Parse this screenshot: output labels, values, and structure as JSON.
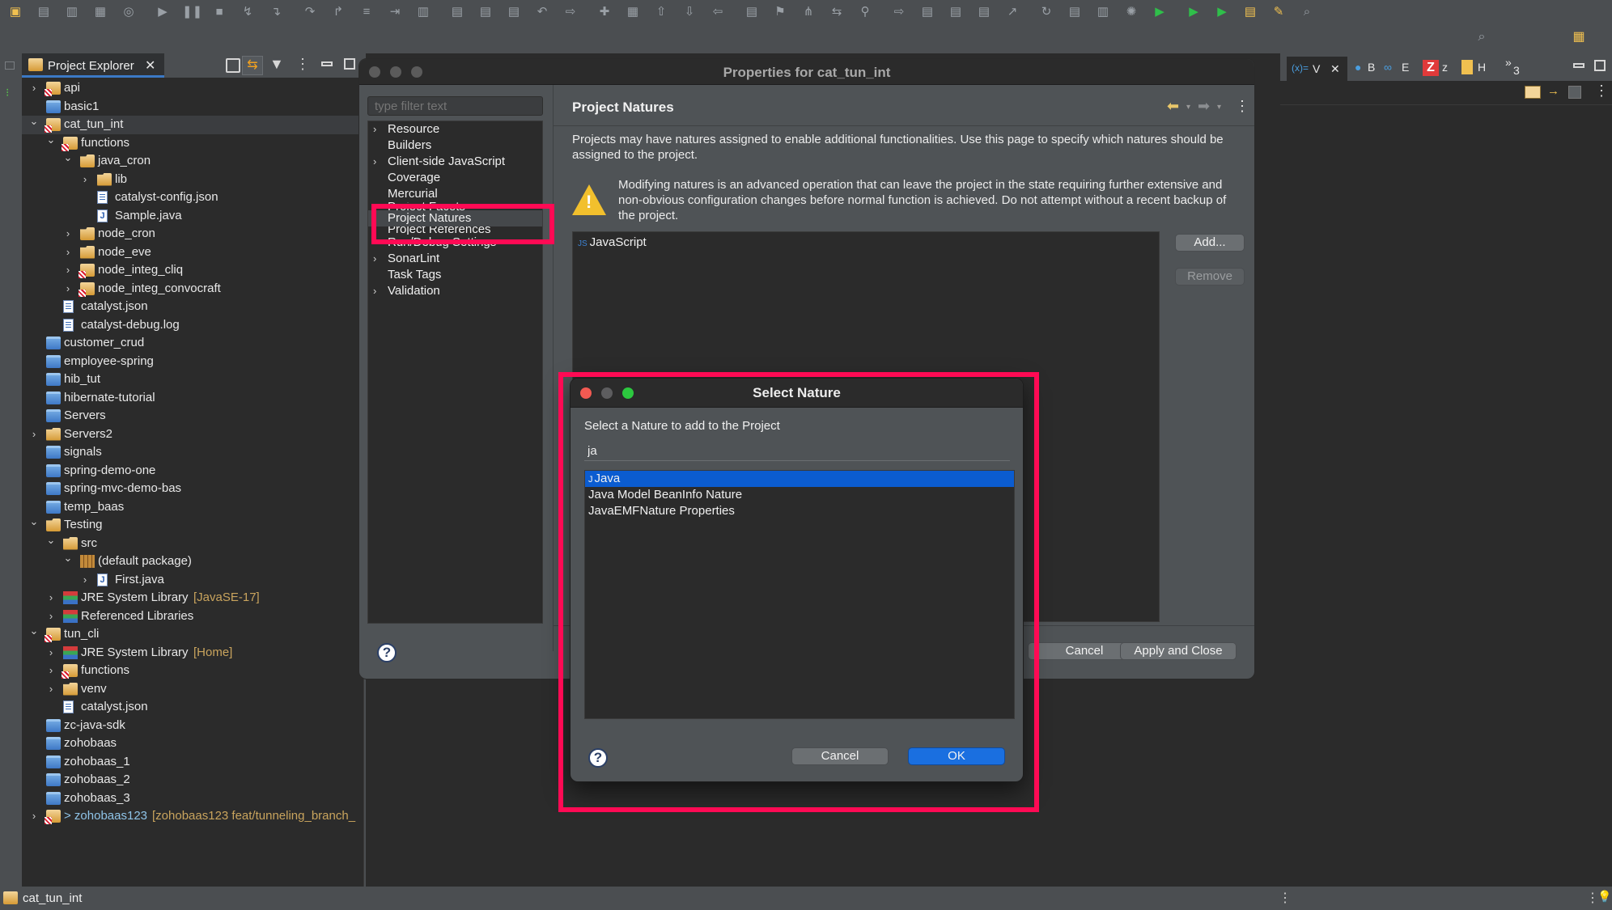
{
  "toolbar": {
    "icons": [
      "new-icon",
      "save-icon",
      "save-all-icon",
      "terminal-icon",
      "skip-breakpoints-icon",
      "resume-icon",
      "suspend-icon",
      "terminate-icon",
      "disconnect-icon",
      "step-into-icon",
      "step-over-icon",
      "step-return-icon",
      "drop-to-frame-icon",
      "use-step-filters-icon",
      "hg-icon-1",
      "hg-icon-2",
      "hg-icon-3",
      "hg-icon-4",
      "hg-undo-icon",
      "hg-import-icon",
      "hg-add-icon",
      "hg-binary-icon",
      "hg-push-icon",
      "hg-pull-icon",
      "hg-incoming-icon",
      "hg-history-icon",
      "hg-tag-icon",
      "hg-merge-icon",
      "hg-branch-icon",
      "hg-bisect-icon",
      "hg-export-icon",
      "hg-patch-icon",
      "hg-shelve-icon",
      "hg-unshelve-icon",
      "hg-rebase-icon",
      "hg-transplant-icon",
      "hg-editor-icon",
      "hg-sign-icon",
      "debug-icon",
      "run-icon",
      "run-last-icon",
      "coverage-icon",
      "open-type-icon",
      "open-task-icon",
      "search-icon"
    ]
  },
  "explorer": {
    "tab_label": "Project Explorer",
    "items": [
      {
        "label": "api",
        "level": 0,
        "chevron": ">",
        "icon": "project"
      },
      {
        "label": "basic1",
        "level": 0,
        "chevron": "",
        "icon": "folder"
      },
      {
        "label": "cat_tun_int",
        "level": 0,
        "chevron": "v",
        "icon": "project",
        "selected": true
      },
      {
        "label": "functions",
        "level": 1,
        "chevron": "v",
        "icon": "project"
      },
      {
        "label": "java_cron",
        "level": 2,
        "chevron": "v",
        "icon": "open"
      },
      {
        "label": "lib",
        "level": 3,
        "chevron": ">",
        "icon": "open"
      },
      {
        "label": "catalyst-config.json",
        "level": 3,
        "chevron": "",
        "icon": "file"
      },
      {
        "label": "Sample.java",
        "level": 3,
        "chevron": "",
        "icon": "java"
      },
      {
        "label": "node_cron",
        "level": 2,
        "chevron": ">",
        "icon": "open"
      },
      {
        "label": "node_eve",
        "level": 2,
        "chevron": ">",
        "icon": "open"
      },
      {
        "label": "node_integ_cliq",
        "level": 2,
        "chevron": ">",
        "icon": "project"
      },
      {
        "label": "node_integ_convocraft",
        "level": 2,
        "chevron": ">",
        "icon": "project"
      },
      {
        "label": "catalyst.json",
        "level": 1,
        "chevron": "",
        "icon": "file"
      },
      {
        "label": "catalyst-debug.log",
        "level": 1,
        "chevron": "",
        "icon": "file"
      },
      {
        "label": "customer_crud",
        "level": 0,
        "chevron": "",
        "icon": "folder"
      },
      {
        "label": "employee-spring",
        "level": 0,
        "chevron": "",
        "icon": "folder"
      },
      {
        "label": "hib_tut",
        "level": 0,
        "chevron": "",
        "icon": "folder"
      },
      {
        "label": "hibernate-tutorial",
        "level": 0,
        "chevron": "",
        "icon": "folder"
      },
      {
        "label": "Servers",
        "level": 0,
        "chevron": "",
        "icon": "folder"
      },
      {
        "label": "Servers2",
        "level": 0,
        "chevron": ">",
        "icon": "open"
      },
      {
        "label": "signals",
        "level": 0,
        "chevron": "",
        "icon": "folder"
      },
      {
        "label": "spring-demo-one",
        "level": 0,
        "chevron": "",
        "icon": "folder"
      },
      {
        "label": "spring-mvc-demo-bas",
        "level": 0,
        "chevron": "",
        "icon": "folder"
      },
      {
        "label": "temp_baas",
        "level": 0,
        "chevron": "",
        "icon": "folder"
      },
      {
        "label": "Testing",
        "level": 0,
        "chevron": "v",
        "icon": "open"
      },
      {
        "label": "src",
        "level": 1,
        "chevron": "v",
        "icon": "open"
      },
      {
        "label": "(default package)",
        "level": 2,
        "chevron": "v",
        "icon": "pkg"
      },
      {
        "label": "First.java",
        "level": 3,
        "chevron": ">",
        "icon": "java"
      },
      {
        "label": "JRE System Library",
        "decoration": "[JavaSE-17]",
        "level": 1,
        "chevron": ">",
        "icon": "lib"
      },
      {
        "label": "Referenced Libraries",
        "level": 1,
        "chevron": ">",
        "icon": "lib"
      },
      {
        "label": "tun_cli",
        "level": 0,
        "chevron": "v",
        "icon": "project"
      },
      {
        "label": "JRE System Library",
        "decoration": "[Home]",
        "level": 1,
        "chevron": ">",
        "icon": "lib"
      },
      {
        "label": "functions",
        "level": 1,
        "chevron": ">",
        "icon": "project"
      },
      {
        "label": "venv",
        "level": 1,
        "chevron": ">",
        "icon": "open"
      },
      {
        "label": "catalyst.json",
        "level": 1,
        "chevron": "",
        "icon": "file"
      },
      {
        "label": "zc-java-sdk",
        "level": 0,
        "chevron": "",
        "icon": "folder"
      },
      {
        "label": "zohobaas",
        "level": 0,
        "chevron": "",
        "icon": "folder"
      },
      {
        "label": "zohobaas_1",
        "level": 0,
        "chevron": "",
        "icon": "folder"
      },
      {
        "label": "zohobaas_2",
        "level": 0,
        "chevron": "",
        "icon": "folder"
      },
      {
        "label": "zohobaas_3",
        "level": 0,
        "chevron": "",
        "icon": "folder"
      },
      {
        "label": "> zohobaas123",
        "decoration": "[zohobaas123 feat/tunneling_branch_",
        "level": 0,
        "chevron": ">",
        "icon": "project",
        "blue": true
      }
    ]
  },
  "properties_dialog": {
    "title": "Properties for cat_tun_int",
    "filter_placeholder": "type filter text",
    "nav_items": [
      {
        "label": "Resource",
        "chevron": ">"
      },
      {
        "label": "Builders",
        "chevron": ""
      },
      {
        "label": "Client-side JavaScript",
        "chevron": ">"
      },
      {
        "label": "Coverage",
        "chevron": ""
      },
      {
        "label": "Mercurial",
        "chevron": ""
      },
      {
        "label": "Project Facets",
        "chevron": "",
        "clipped": "bottom"
      },
      {
        "label": "Project Natures",
        "chevron": "",
        "selected": true
      },
      {
        "label": "Project References",
        "chevron": "",
        "clipped": "top"
      },
      {
        "label": "Run/Debug Settings",
        "chevron": ""
      },
      {
        "label": "SonarLint",
        "chevron": ">"
      },
      {
        "label": "Task Tags",
        "chevron": ""
      },
      {
        "label": "Validation",
        "chevron": ">"
      }
    ],
    "page_title": "Project Natures",
    "description": "Projects may have natures assigned to enable additional functionalities. Use this page to specify which natures should be assigned to the project.",
    "warning": "Modifying natures is an advanced operation that can leave the project in the state requiring further extensive and non-obvious configuration changes before normal function is achieved. Do not attempt without a recent backup of the project.",
    "natures": [
      {
        "label": "JavaScript",
        "icon_text": "JS"
      }
    ],
    "add_label": "Add...",
    "remove_label": "Remove",
    "cancel_label": "Cancel",
    "apply_close_label": "Apply and Close"
  },
  "select_nature_dialog": {
    "title": "Select Nature",
    "prompt": "Select a Nature to add to the Project",
    "filter_value": "ja",
    "items": [
      {
        "label": "Java",
        "selected": true,
        "icon_text": "J"
      },
      {
        "label": "Java Model BeanInfo Nature",
        "selected": false
      },
      {
        "label": "JavaEMFNature Properties",
        "selected": false
      }
    ],
    "cancel_label": "Cancel",
    "ok_label": "OK"
  },
  "right_panel": {
    "tabs": [
      {
        "label": "V",
        "icon_text": "(x)="
      },
      {
        "label": "B"
      },
      {
        "label": "E"
      },
      {
        "label": "z"
      },
      {
        "label": "H"
      },
      {
        "label": "3",
        "icon_text": "»"
      }
    ]
  },
  "statusbar": {
    "text": "cat_tun_int"
  },
  "colors": {
    "highlight": "#ff0a54",
    "selection": "#0b5cd0",
    "ok_button": "#1a6fe0"
  }
}
